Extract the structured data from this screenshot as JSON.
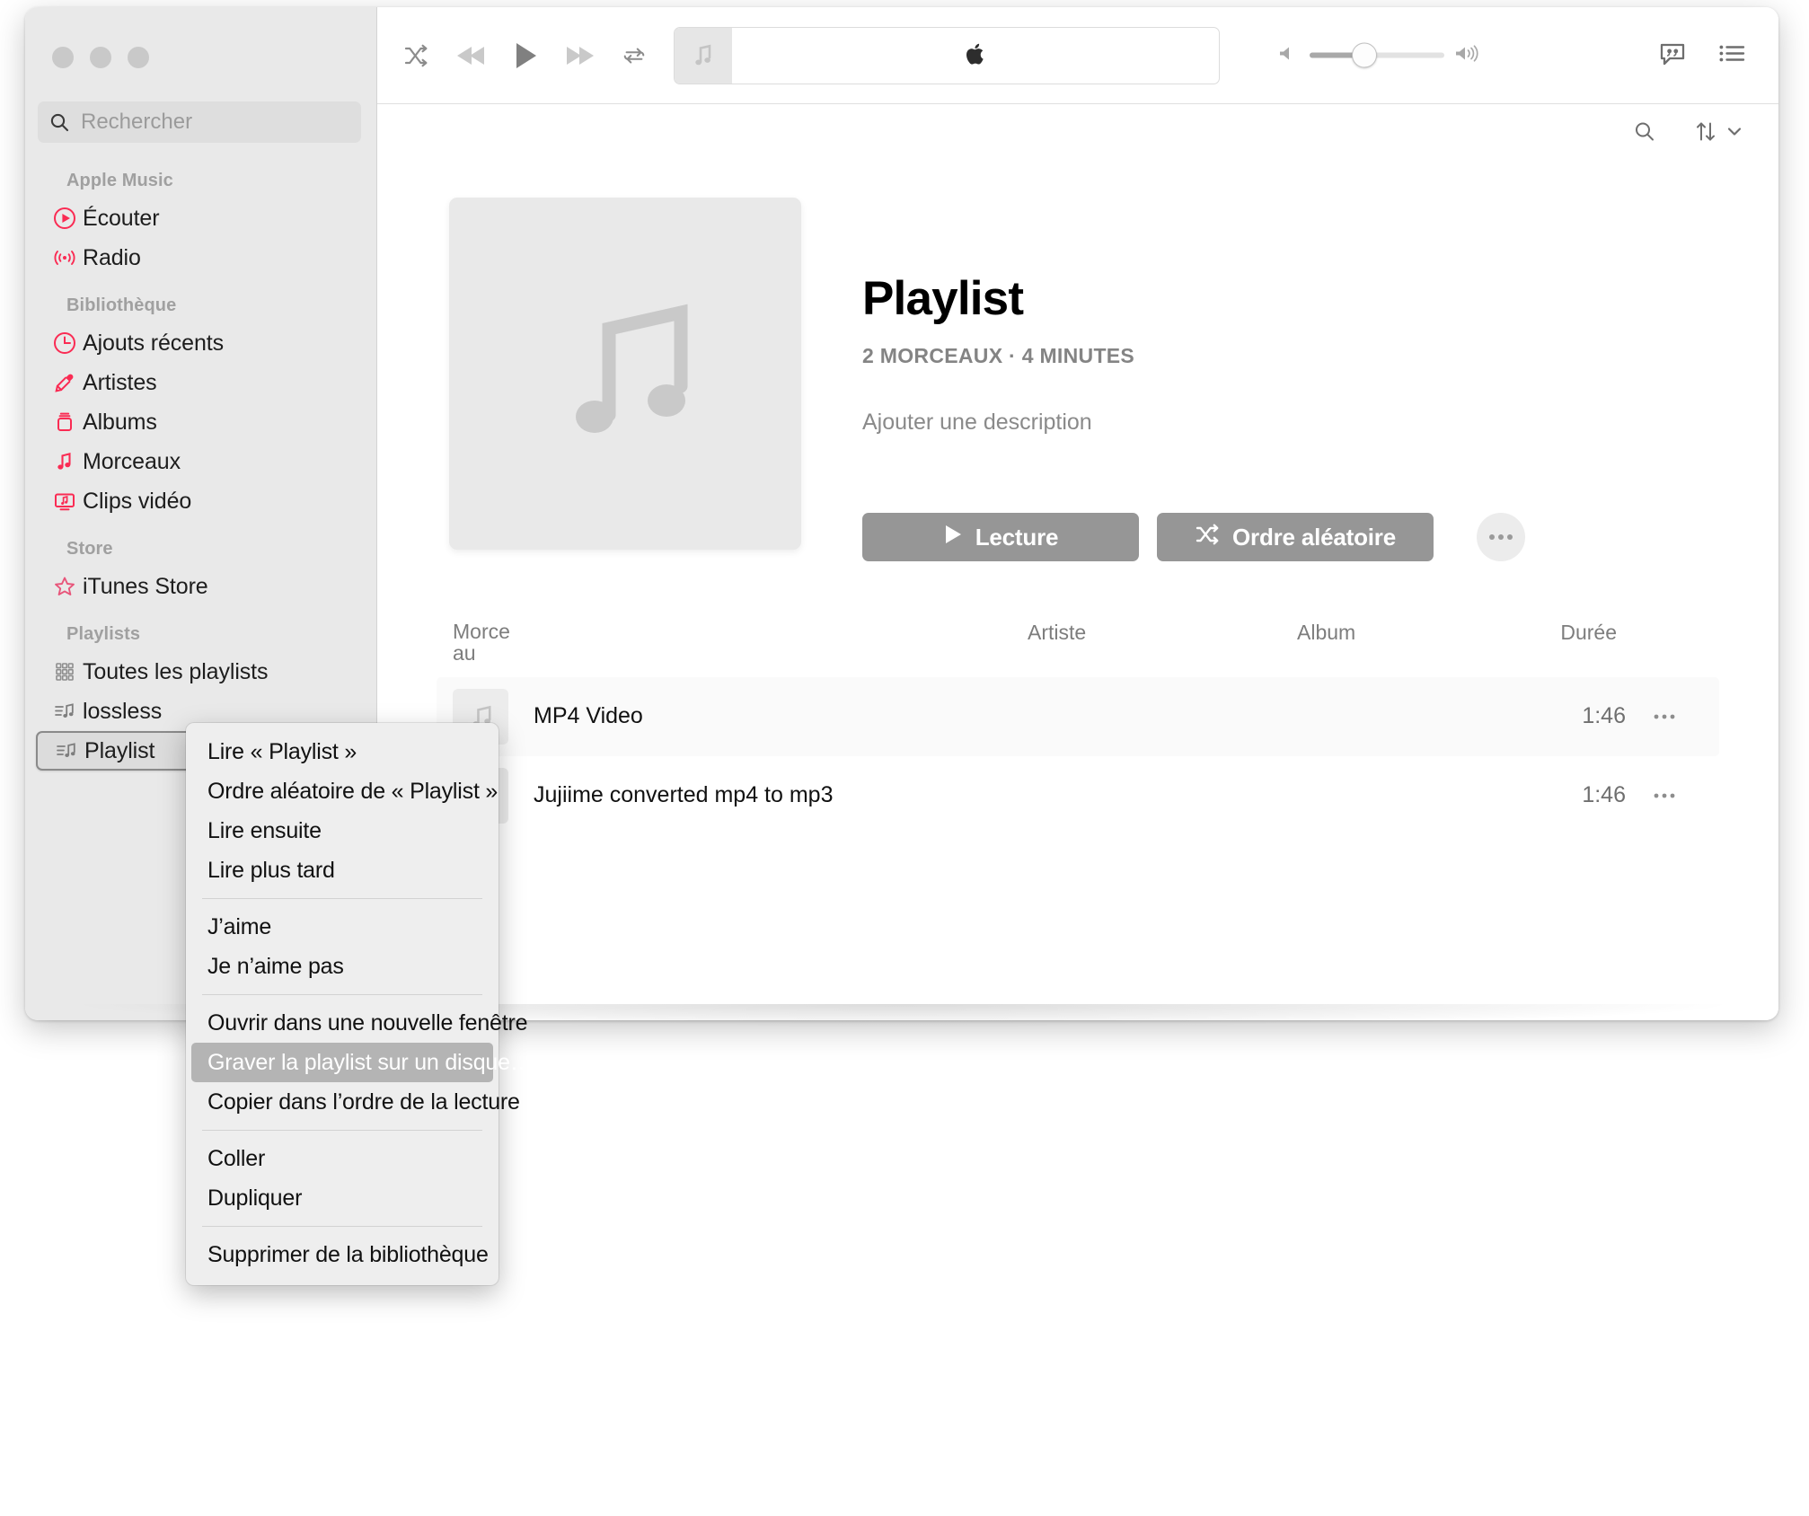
{
  "window": {
    "traffic_lights": [
      "close",
      "minimize",
      "zoom"
    ]
  },
  "search": {
    "placeholder": "Rechercher",
    "value": ""
  },
  "sidebar": {
    "groups": [
      {
        "title": "Apple Music",
        "items": [
          {
            "label": "Écouter",
            "icon": "play-circle-icon"
          },
          {
            "label": "Radio",
            "icon": "radio-waves-icon"
          }
        ]
      },
      {
        "title": "Bibliothèque",
        "items": [
          {
            "label": "Ajouts récents",
            "icon": "clock-icon"
          },
          {
            "label": "Artistes",
            "icon": "microphone-icon"
          },
          {
            "label": "Albums",
            "icon": "album-stack-icon"
          },
          {
            "label": "Morceaux",
            "icon": "music-note-icon"
          },
          {
            "label": "Clips vidéo",
            "icon": "video-clip-icon"
          }
        ]
      },
      {
        "title": "Store",
        "items": [
          {
            "label": "iTunes Store",
            "icon": "star-icon"
          }
        ]
      },
      {
        "title": "Playlists",
        "items": [
          {
            "label": "Toutes les playlists",
            "icon": "grid-dots-icon"
          },
          {
            "label": "lossless",
            "icon": "playlist-note-icon"
          },
          {
            "label": "Playlist",
            "icon": "playlist-note-icon",
            "selected": true
          }
        ]
      }
    ]
  },
  "toolbar": {
    "shuffle": "shuffle-icon",
    "previous": "rewind-icon",
    "play": "play-icon",
    "next": "fast-forward-icon",
    "repeat": "repeat-icon",
    "now_playing_art": "music-note-icon",
    "now_playing_logo": "apple-logo-icon",
    "volume_min": "volume-low-icon",
    "volume_max": "volume-high-icon",
    "volume_percent": 38,
    "lyrics": "lyrics-bubble-icon",
    "queue": "queue-list-icon"
  },
  "subbar": {
    "search": "search-icon",
    "sort": "sort-arrows-icon",
    "sort_chevron": "chevron-down-icon"
  },
  "hero": {
    "artwork_icon": "music-note-icon",
    "title": "Playlist",
    "meta": "2 MORCEAUX · 4 MINUTES",
    "description_placeholder": "Ajouter une description",
    "play_label": "Lecture",
    "play_icon": "play-icon",
    "shuffle_label": "Ordre aléatoire",
    "shuffle_icon": "shuffle-icon",
    "more_icon": "ellipsis-icon"
  },
  "tracks": {
    "columns": {
      "song_line1": "Morce",
      "song_line2": "au",
      "artist": "Artiste",
      "album": "Album",
      "duration": "Durée"
    },
    "rows": [
      {
        "artwork_icon": "music-note-icon",
        "name": "MP4 Video",
        "artist": "",
        "album": "",
        "duration": "1:46",
        "more_icon": "ellipsis-icon"
      },
      {
        "artwork_icon": "music-note-icon",
        "name": "Jujiime converted mp4 to mp3",
        "artist": "",
        "album": "",
        "duration": "1:46",
        "more_icon": "ellipsis-icon"
      }
    ]
  },
  "context_menu": {
    "sections": [
      {
        "items": [
          "Lire « Playlist »",
          "Ordre aléatoire de « Playlist »",
          "Lire ensuite",
          "Lire plus tard"
        ]
      },
      {
        "items": [
          "J’aime",
          "Je n’aime pas"
        ]
      },
      {
        "items": [
          "Ouvrir dans une nouvelle fenêtre",
          "Graver la playlist sur un disque…",
          "Copier dans l’ordre de la lecture"
        ],
        "highlighted": "Graver la playlist sur un disque…"
      },
      {
        "items": [
          "Coller",
          "Dupliquer"
        ]
      },
      {
        "items": [
          "Supprimer de la bibliothèque"
        ]
      }
    ]
  },
  "colors": {
    "accent_red": "#fa2b53",
    "sidebar_bg": "#e9e9e9",
    "button_gray": "#969696",
    "menu_highlight": "#b4b4b4"
  }
}
